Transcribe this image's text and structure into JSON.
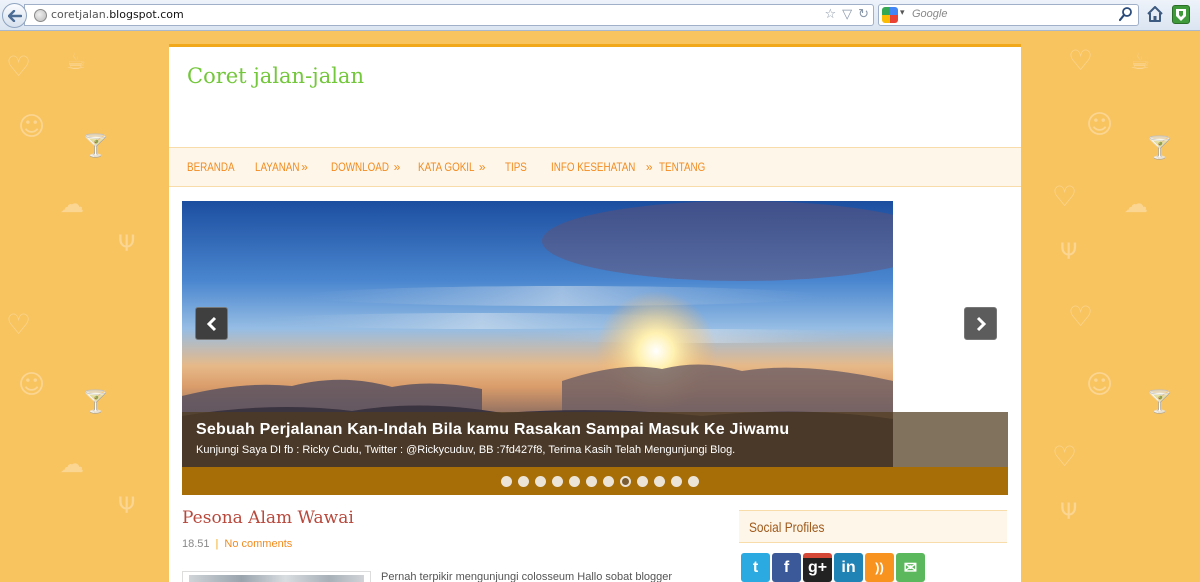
{
  "browser": {
    "url_domain_prefix": "coretjalan.",
    "url_domain_main": "blogspot.com",
    "search_placeholder": "Google",
    "icons": [
      "back-arrow-icon",
      "globe-icon",
      "star-icon",
      "dropdown-icon",
      "reload-icon",
      "google-icon",
      "search-icon",
      "home-icon",
      "addon-icon"
    ]
  },
  "blog": {
    "title": "Coret jalan-jalan"
  },
  "nav": {
    "items": [
      {
        "label": "Beranda",
        "has_submenu": false
      },
      {
        "label": "Layanan",
        "has_submenu": true
      },
      {
        "label": "Download",
        "has_submenu": true
      },
      {
        "label": "Kata Gokil",
        "has_submenu": true
      },
      {
        "label": "Tips",
        "has_submenu": false
      },
      {
        "label": "Info Kesehatan",
        "has_submenu": true
      },
      {
        "label": "Tentang",
        "has_submenu": false
      }
    ],
    "submenu_caret": "»"
  },
  "slider": {
    "caption_title": "Sebuah Perjalanan Kan-Indah Bila kamu Rasakan Sampai Masuk Ke Jiwamu",
    "caption_text": "Kunjungi Saya DI fb : Ricky Cudu, Twitter : @Rickycuduv, BB :7fd427f8, Terima Kasih Telah Mengunjungi Blog.",
    "slide_count": 12,
    "active_slide": 8
  },
  "post": {
    "title": "Pesona Alam Wawai",
    "time": "18.51",
    "separator": "|",
    "comments_label": "No comments",
    "excerpt": "Pernah terpikir mengunjungi colosseum Hallo sobat blogger"
  },
  "sidebar": {
    "widget_title": "Social Profiles",
    "social_profiles": [
      {
        "name": "twitter",
        "icon": "twitter-icon",
        "color": "#2ba9e1"
      },
      {
        "name": "facebook",
        "icon": "facebook-icon",
        "color": "#3b5998"
      },
      {
        "name": "google-plus",
        "icon": "google-plus-icon",
        "color": "#222222"
      },
      {
        "name": "linkedin",
        "icon": "linkedin-icon",
        "color": "#1f83b6"
      },
      {
        "name": "rss",
        "icon": "rss-icon",
        "color": "#f7931e"
      },
      {
        "name": "email",
        "icon": "email-icon",
        "color": "#5cb85c"
      }
    ]
  },
  "colors": {
    "background": "#f8c460",
    "accent": "#f28b1f",
    "title_green": "#73c73a",
    "post_title": "#b8483c",
    "slider_bar": "#a76d06"
  }
}
